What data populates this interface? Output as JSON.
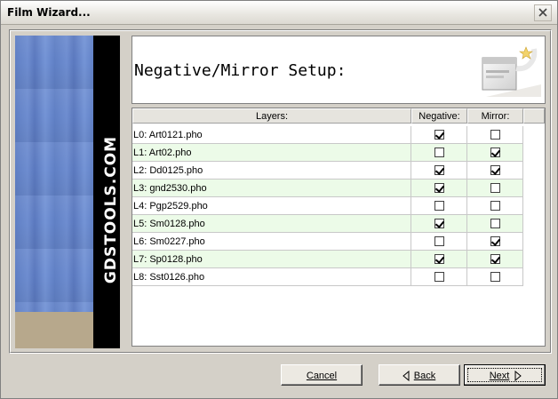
{
  "window": {
    "title": "Film Wizard..."
  },
  "banner": {
    "logo_text": "GDSTOOLS.COM"
  },
  "header": {
    "heading": "Negative/Mirror Setup:"
  },
  "grid": {
    "columns": {
      "layers": "Layers:",
      "negative": "Negative:",
      "mirror": "Mirror:"
    },
    "rows": [
      {
        "name": "L0: Art0121.pho",
        "negative": true,
        "mirror": false
      },
      {
        "name": "L1: Art02.pho",
        "negative": false,
        "mirror": true
      },
      {
        "name": "L2: Dd0125.pho",
        "negative": true,
        "mirror": true
      },
      {
        "name": "L3: gnd2530.pho",
        "negative": true,
        "mirror": false
      },
      {
        "name": "L4: Pgp2529.pho",
        "negative": false,
        "mirror": false
      },
      {
        "name": "L5: Sm0128.pho",
        "negative": true,
        "mirror": false
      },
      {
        "name": "L6: Sm0227.pho",
        "negative": false,
        "mirror": true
      },
      {
        "name": "L7: Sp0128.pho",
        "negative": true,
        "mirror": true
      },
      {
        "name": "L8: Sst0126.pho",
        "negative": false,
        "mirror": false
      }
    ]
  },
  "buttons": {
    "cancel": "Cancel",
    "back": "Back",
    "next": "Next"
  },
  "colors": {
    "row_alt": "#ecfbe8",
    "banner_blue": "#6e8dd0",
    "banner_tan": "#b7a88c"
  }
}
